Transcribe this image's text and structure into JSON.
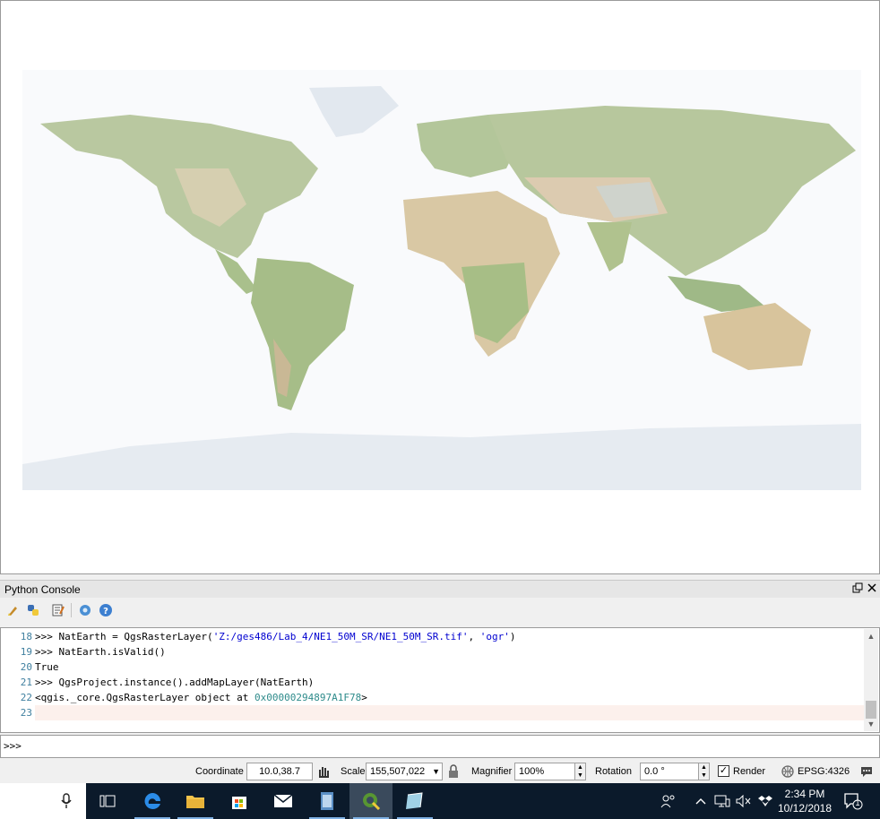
{
  "console": {
    "title": "Python Console",
    "lines": [
      {
        "n": "18",
        "pre": ">>> NatEarth = QgsRasterLayer(",
        "s1": "'Z:/ges486/Lab_4/NE1_50M_SR/NE1_50M_SR.tif'",
        "mid": ", ",
        "s2": "'ogr'",
        "post": ")"
      },
      {
        "n": "19",
        "text": ">>> NatEarth.isValid()"
      },
      {
        "n": "20",
        "text": "True"
      },
      {
        "n": "21",
        "text": ">>> QgsProject.instance().addMapLayer(NatEarth)"
      },
      {
        "n": "22",
        "pre": "<qgis._core.QgsRasterLayer object at ",
        "hex": "0x00000294897A1F78",
        "post": ">"
      },
      {
        "n": "23",
        "text": ""
      }
    ],
    "input_prompt": ">>>"
  },
  "statusbar": {
    "coordinate_label": "Coordinate",
    "coordinate_value": "10.0,38.7",
    "scale_label": "Scale",
    "scale_value": "155,507,022",
    "magnifier_label": "Magnifier",
    "magnifier_value": "100%",
    "rotation_label": "Rotation",
    "rotation_value": "0.0 °",
    "render_label": "Render",
    "render_checked": true,
    "crs_label": "EPSG:4326"
  },
  "taskbar": {
    "time": "2:34 PM",
    "date": "10/12/2018",
    "notification_count": "1",
    "apps": [
      "task-view-icon",
      "edge-icon",
      "file-explorer-icon",
      "store-icon",
      "mail-icon",
      "video-icon",
      "qgis-icon",
      "app-icon"
    ]
  },
  "colors": {
    "accent": "#7fb2e5",
    "taskbar": "#0b1a2b",
    "linenum": "#3f7f9f",
    "string": "#0000d0",
    "hex": "#2e8b8b"
  }
}
